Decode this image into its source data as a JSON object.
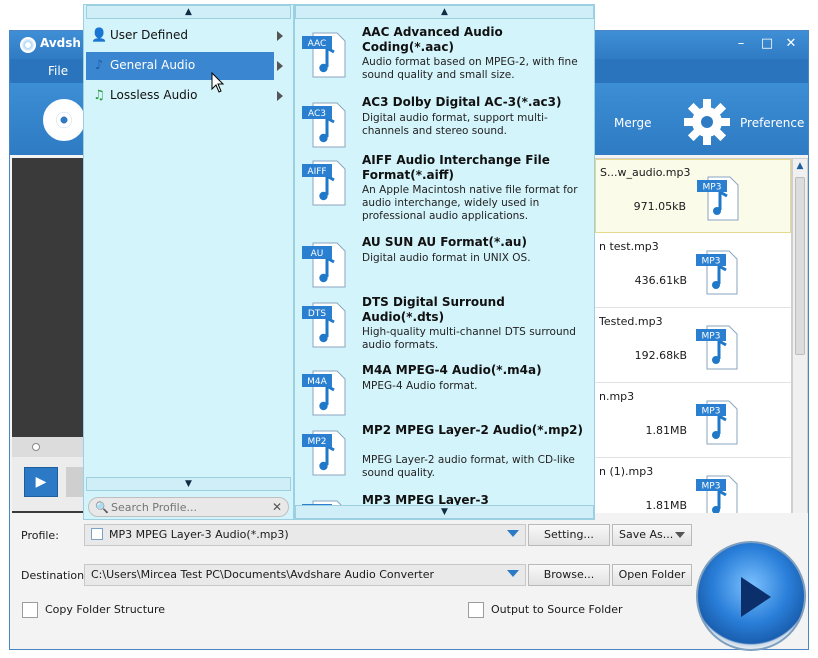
{
  "app": {
    "title": "Avdsh",
    "menu_file": "File",
    "toolbar": {
      "merge": "Merge",
      "preference": "Preference"
    }
  },
  "categories": [
    {
      "label": "User Defined",
      "icon": "user-icon"
    },
    {
      "label": "General Audio",
      "icon": "music-note-icon",
      "selected": true
    },
    {
      "label": "Lossless Audio",
      "icon": "music-note-green-icon"
    }
  ],
  "search": {
    "placeholder": "Search Profile..."
  },
  "formats": [
    {
      "tag": "AAC",
      "title": "AAC Advanced Audio Coding(*.aac)",
      "desc": "Audio format based on MPEG-2, with fine sound quality and small size."
    },
    {
      "tag": "AC3",
      "title": "AC3 Dolby Digital AC-3(*.ac3)",
      "desc": "Digital audio format, support multi-channels and stereo sound."
    },
    {
      "tag": "AIFF",
      "title": "AIFF Audio Interchange File Format(*.aiff)",
      "desc": "An Apple Macintosh native file format for audio interchange, widely used in professional audio applications."
    },
    {
      "tag": "AU",
      "title": "AU SUN AU Format(*.au)",
      "desc": "Digital audio format in UNIX OS."
    },
    {
      "tag": "DTS",
      "title": "DTS Digital Surround Audio(*.dts)",
      "desc": "High-quality multi-channel DTS surround audio formats."
    },
    {
      "tag": "M4A",
      "title": "M4A MPEG-4 Audio(*.m4a)",
      "desc": "MPEG-4 Audio format."
    },
    {
      "tag": "MP2",
      "title": "MP2 MPEG Layer-2 Audio(*.mp2)",
      "desc": "MPEG Layer-2 audio format, with CD-like sound quality."
    },
    {
      "tag": "MP3",
      "title": "MP3 MPEG Layer-3",
      "desc": ""
    }
  ],
  "files": [
    {
      "name": "S...w_audio.mp3",
      "size": "971.05kB",
      "tag": "MP3"
    },
    {
      "name": "n test.mp3",
      "size": "436.61kB",
      "tag": "MP3"
    },
    {
      "name": "Tested.mp3",
      "size": "192.68kB",
      "tag": "MP3"
    },
    {
      "name": "n.mp3",
      "size": "1.81MB",
      "tag": "MP3"
    },
    {
      "name": "n (1).mp3",
      "size": "1.81MB",
      "tag": "MP3"
    }
  ],
  "bottom": {
    "profile_label": "Profile:",
    "profile_value": "MP3 MPEG Layer-3 Audio(*.mp3)",
    "setting_button": "Setting...",
    "save_as_button": "Save As...",
    "destination_label": "Destination:",
    "destination_value": "C:\\Users\\Mircea Test PC\\Documents\\Avdshare Audio Converter",
    "browse_button": "Browse...",
    "open_folder_button": "Open Folder",
    "copy_folder_label": "Copy Folder Structure",
    "output_source_label": "Output to Source Folder"
  },
  "colors": {
    "accent": "#2e7bc3",
    "menu_bg": "#d4f4fb",
    "selection": "#3b86d1"
  }
}
